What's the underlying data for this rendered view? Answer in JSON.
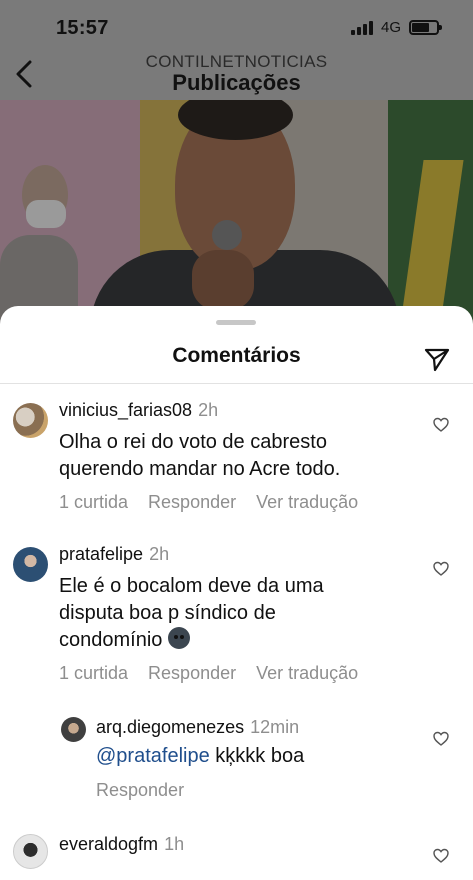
{
  "status_bar": {
    "time": "15:57",
    "network": "4G"
  },
  "header": {
    "account": "CONTILNETNOTICIAS",
    "title": "Publicações"
  },
  "sheet": {
    "title": "Comentários"
  },
  "comments": [
    {
      "user": "vinicius_farias08",
      "time": "2h",
      "text_lines": [
        "Olha o rei do voto de cabresto",
        "querendo mandar no Acre todo."
      ],
      "likes": "1 curtida",
      "reply": "Responder",
      "translate": "Ver tradução"
    },
    {
      "user": "pratafelipe",
      "time": "2h",
      "text_lines": [
        "Ele é o bocalom deve da uma",
        "disputa boa p síndico de",
        "condomínio"
      ],
      "likes": "1 curtida",
      "reply": "Responder",
      "translate": "Ver tradução"
    },
    {
      "user": "arq.diegomenezes",
      "time": "12min",
      "mention": "@pratafelipe",
      "text": " kķkkk boa",
      "reply": "Responder"
    },
    {
      "user": "everaldogfm",
      "time": "1h"
    }
  ],
  "icons": {
    "back": "chevron-left-icon",
    "share": "paper-plane-icon",
    "like": "heart-outline-icon"
  }
}
